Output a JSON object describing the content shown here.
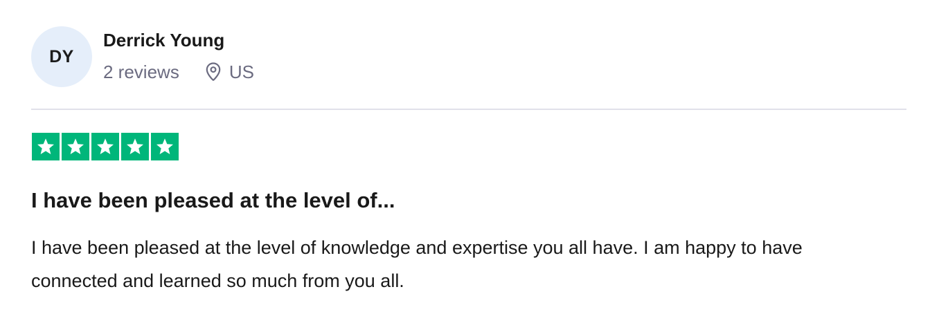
{
  "reviewer": {
    "initials": "DY",
    "name": "Derrick Young",
    "review_count": "2 reviews",
    "location": "US",
    "avatar_bg": "#e5eefa"
  },
  "rating": {
    "stars": 5,
    "max": 5,
    "color": "#00b67a",
    "icon": "star-icon"
  },
  "review": {
    "title": "I have been pleased at the level of...",
    "body": "I have been pleased at the level of knowledge and expertise you all have. I am happy to have connected and learned so much from you all."
  },
  "icons": {
    "location": "map-pin-icon"
  }
}
